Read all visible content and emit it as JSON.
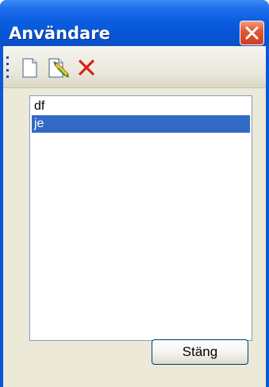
{
  "window": {
    "title": "Användare"
  },
  "toolbar": {
    "buttons": [
      {
        "icon": "new-document-icon"
      },
      {
        "icon": "edit-document-icon"
      },
      {
        "icon": "delete-icon"
      }
    ]
  },
  "users": {
    "items": [
      {
        "label": "df",
        "selected": false
      },
      {
        "label": "je",
        "selected": true
      }
    ]
  },
  "footer": {
    "close_label": "Stäng"
  },
  "colors": {
    "titlebar": "#0755d6",
    "selection": "#316ac5",
    "face": "#ece9d8"
  }
}
